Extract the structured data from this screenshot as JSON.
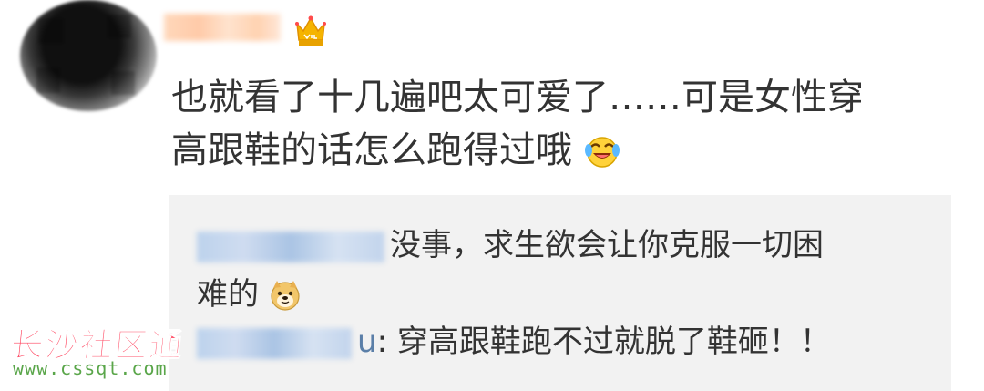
{
  "comment": {
    "text_line1": "也就看了十几遍吧太可爱了……可是女性穿",
    "text_line2": "高跟鞋的话怎么跑得过哦"
  },
  "replies": [
    {
      "text_line1": "没事，求生欲会让你克服一切困",
      "text_line2": "难的"
    },
    {
      "suffix": "u",
      "text": ": 穿高跟鞋跑不过就脱了鞋砸！！"
    }
  ],
  "watermark": {
    "title": "长沙社区通",
    "url": "www.cssqt.com"
  },
  "icons": {
    "vip": "vip-crown-icon",
    "laughing": "laughing-crying-emoji-icon",
    "doge": "doge-emoji-icon"
  }
}
